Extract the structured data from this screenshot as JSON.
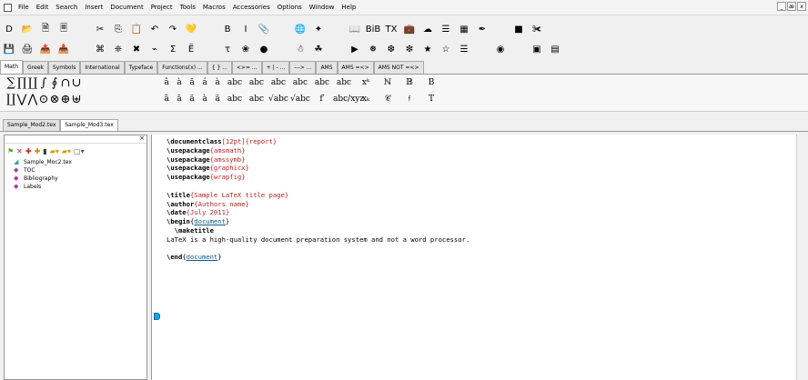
{
  "menu": [
    "File",
    "Edit",
    "Search",
    "Insert",
    "Document",
    "Project",
    "Tools",
    "Macros",
    "Accessories",
    "Options",
    "Window",
    "Help"
  ],
  "window_controls": [
    "_",
    "æ",
    "x"
  ],
  "toolbar1": [
    "D",
    "📂",
    "🗎",
    "🗏",
    "",
    "✂",
    "⎘",
    "📋",
    "↶",
    "↷",
    "💛",
    "",
    "B",
    "I",
    "📎",
    "",
    "🌐",
    "✦",
    "",
    "📖",
    "BiB",
    "TX",
    "💼",
    "☁",
    "☰",
    "▦",
    "✒",
    "",
    "■",
    "✀"
  ],
  "toolbar2": [
    "💾",
    "🖨",
    "📤",
    "📥",
    "",
    "⌘",
    "❈",
    "✖",
    "⌁",
    "Σ",
    "Ë",
    "",
    "τ",
    "❀",
    "●",
    "",
    "☃",
    "☘",
    "",
    "▶",
    "❅",
    "❆",
    "❇",
    "★",
    "☆",
    "☰",
    "",
    "◉",
    "",
    "▣",
    "▤"
  ],
  "symbol_tabs": [
    "Math",
    "Greek",
    "Symbols",
    "International",
    "Typeface",
    "Functions(x) ...",
    "{ } ...",
    "<>= ...",
    "+ | - ...",
    "---> ...",
    "AMS",
    "AMS =<>",
    "AMS NOT =<>"
  ],
  "symbols_row1": [
    "∑",
    "∏",
    "∐",
    "∫",
    "∮",
    "∩",
    "∪"
  ],
  "symbols_row2": [
    "∐",
    "⋁",
    "⋀",
    "⊙",
    "⊗",
    "⊕",
    "⊎"
  ],
  "accents_row1": [
    "â",
    "à",
    "ă",
    "á",
    "à"
  ],
  "accents_row2": [
    "ã",
    "ā",
    "ä",
    "à",
    "ä"
  ],
  "wide_row1": [
    "abc",
    "abc",
    "abc",
    "abc",
    "abc",
    "abc",
    "xᵏ",
    "ℕ",
    "𝔹",
    "B"
  ],
  "wide_row2": [
    "abc",
    "abc",
    "√abc",
    "√abc",
    "f′",
    "abc/xyz",
    "xₖ",
    "𝒞",
    "𝔣",
    "T"
  ],
  "doc_tabs": [
    "Sample_Mod2.tex",
    "Sample_Mod3.tex"
  ],
  "tree": [
    "Sample_Moc2.tex",
    "TOC",
    "Bibliography",
    "Labels"
  ],
  "code_lines": [
    [
      "\\documentclass",
      "[12pt]",
      "{report}"
    ],
    [
      "\\usepackage",
      "",
      "{amsmath}"
    ],
    [
      "\\usepackage",
      "",
      "{amssymb}"
    ],
    [
      "\\usepackage",
      "",
      "{graphicx}"
    ],
    [
      "\\usepackage",
      "",
      "{wrapfig}"
    ],
    [
      "",
      "",
      ""
    ],
    [
      "\\title",
      "",
      "{Sample LaTeX title page}"
    ],
    [
      "\\author",
      "",
      "{Authors name}"
    ],
    [
      "\\date",
      "",
      "{July 2011}"
    ],
    [
      "\\begin",
      "",
      "{document}"
    ],
    [
      "  \\maketitle",
      "",
      ""
    ],
    [
      "LaTeX is a high-quality document preparation system and not a word processor.",
      "",
      ""
    ],
    [
      "",
      "",
      ""
    ],
    [
      "\\end",
      "",
      "{document}"
    ]
  ]
}
